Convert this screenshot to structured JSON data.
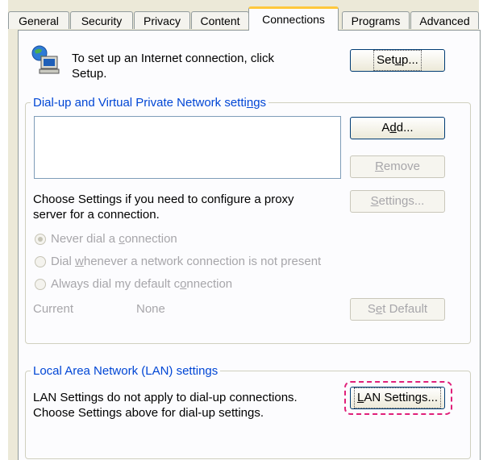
{
  "tabs": [
    {
      "label": "General",
      "active": false
    },
    {
      "label": "Security",
      "active": false
    },
    {
      "label": "Privacy",
      "active": false
    },
    {
      "label": "Content",
      "active": false
    },
    {
      "label": "Connections",
      "active": true
    },
    {
      "label": "Programs",
      "active": false
    },
    {
      "label": "Advanced",
      "active": false
    }
  ],
  "setup": {
    "icon": "network-computer-icon",
    "text_line1": "To set up an Internet connection, click",
    "text_line2": "Setup.",
    "button_pre": "Set",
    "button_accel": "u",
    "button_post": "p..."
  },
  "dialup": {
    "title_pre": "Dial-up and Virtual Private Network setti",
    "title_accel": "n",
    "title_post": "gs",
    "add_pre": "A",
    "add_accel": "d",
    "add_post": "d...",
    "remove_accel": "R",
    "remove_post": "emove",
    "settings_accel": "S",
    "settings_post": "ettings...",
    "proxy_line1": "Choose Settings if you need to configure a proxy",
    "proxy_line2": "server for a connection.",
    "radio1_pre": "Never dial a ",
    "radio1_accel": "c",
    "radio1_post": "onnection",
    "radio2_pre": "Dial ",
    "radio2_accel": "w",
    "radio2_post": "henever a network connection is not present",
    "radio3_pre": "Always dial my default c",
    "radio3_accel": "o",
    "radio3_post": "nnection",
    "selected_radio": 1,
    "current_label": "Current",
    "current_value": "None",
    "set_default_pre": "S",
    "set_default_accel": "e",
    "set_default_post": "t Default"
  },
  "lan": {
    "title": "Local Area Network (LAN) settings",
    "line1": "LAN Settings do not apply to dial-up connections.",
    "line2": "Choose Settings above for dial-up settings.",
    "button_accel": "L",
    "button_post": "AN Settings...",
    "highlight_color": "#e0207a"
  },
  "colors": {
    "group_title": "#0046d5",
    "tab_active_accent": "#ffc83c",
    "dialog_bg": "#ece9d8"
  }
}
